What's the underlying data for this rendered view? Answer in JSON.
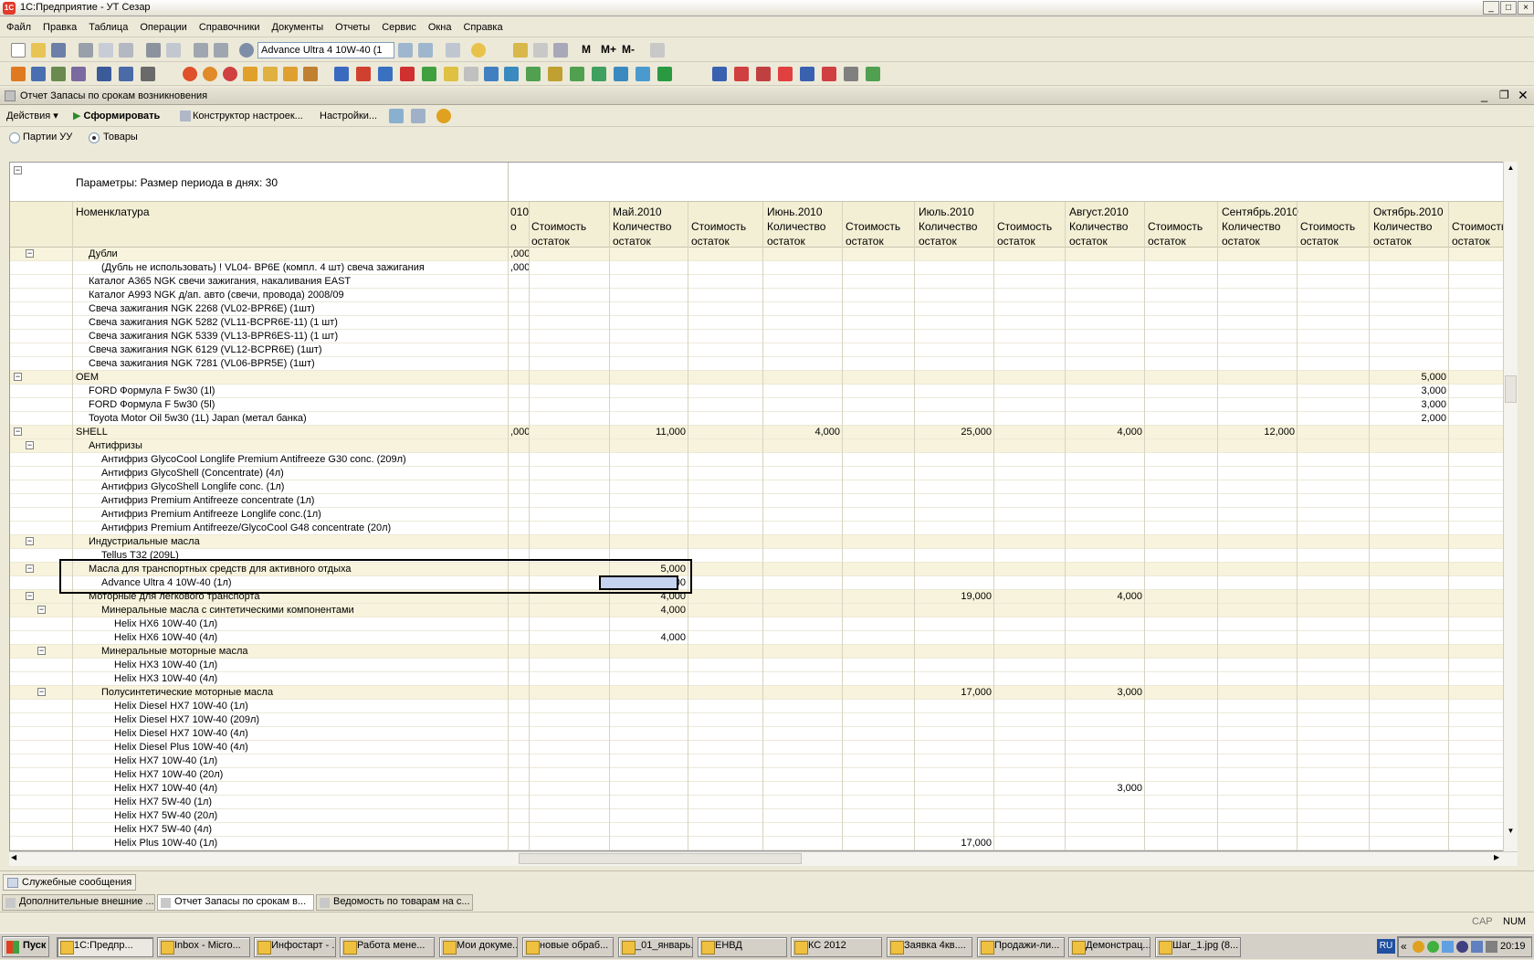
{
  "app": {
    "title": "1С:Предприятие - УТ Сезар",
    "logo": "1С"
  },
  "menu": [
    "Файл",
    "Правка",
    "Таблица",
    "Операции",
    "Справочники",
    "Документы",
    "Отчеты",
    "Сервис",
    "Окна",
    "Справка"
  ],
  "toolbar": {
    "search_value": "Advance Ultra 4 10W-40 (1",
    "mem_buttons": [
      "M",
      "M+",
      "M-"
    ]
  },
  "report": {
    "title": "Отчет  Запасы по срокам возникновения",
    "actions": {
      "actions": "Действия",
      "generate": "Сформировать",
      "constructor": "Конструктор настроек...",
      "settings": "Настройки..."
    },
    "radio": {
      "opt1": "Партии УУ",
      "opt2": "Товары",
      "selected": "opt2"
    },
    "params": "Параметры:     Размер периода в днях: 30",
    "col_nom": "Номенклатура",
    "first_month_tail": "010",
    "months": [
      "Май.2010",
      "Июнь.2010",
      "Июль.2010",
      "Август.2010",
      "Сентябрь.2010",
      "Октябрь.2010"
    ],
    "qty_label_1": "Количество",
    "qty_label_2": "остаток",
    "cost_label_1": "Стоимость",
    "cost_label_2": "остаток",
    "first_col_tail": "о",
    "rows": [
      {
        "name": "Дубли",
        "indent": 1,
        "group": true,
        "pre": ",000"
      },
      {
        "name": "(Дубль не использовать) ! VL04- BP6E  (компл. 4 шт) свеча зажигания",
        "indent": 2,
        "pre": ",000"
      },
      {
        "name": "Каталог A365 NGK свечи зажигания, накаливания EAST",
        "indent": 1
      },
      {
        "name": "Каталог A993 NGK д/ап. авто (свечи, провода) 2008/09",
        "indent": 1
      },
      {
        "name": "Свеча зажигания NGK 2268  (VL02-BPR6E) (1шт)",
        "indent": 1
      },
      {
        "name": "Свеча зажигания NGK 5282 (VL11-BCPR6E-11) (1 шт)",
        "indent": 1
      },
      {
        "name": "Свеча зажигания NGK 5339 (VL13-BPR6ES-11) (1 шт)",
        "indent": 1
      },
      {
        "name": "Свеча зажигания NGK 6129 (VL12-BCPR6E) (1шт)",
        "indent": 1
      },
      {
        "name": "Свеча зажигания NGK 7281 (VL06-BPR5E) (1шт)",
        "indent": 1
      },
      {
        "name": "OEM",
        "indent": 0,
        "group": true,
        "v": {
          "oct": "5,000"
        }
      },
      {
        "name": "FORD Формула F 5w30 (1l)",
        "indent": 1,
        "v": {
          "oct": "3,000"
        }
      },
      {
        "name": "FORD Формула F 5w30 (5l)",
        "indent": 1,
        "v": {
          "oct": "3,000"
        }
      },
      {
        "name": "Toyota Motor Oil 5w30 (1L) Japan (метал банка)",
        "indent": 1,
        "v": {
          "oct": "2,000"
        }
      },
      {
        "name": "SHELL",
        "indent": 0,
        "group": true,
        "pre": ",000",
        "v": {
          "may": "11,000",
          "jun": "4,000",
          "jul": "25,000",
          "aug": "4,000",
          "sep": "12,000"
        }
      },
      {
        "name": "Антифризы",
        "indent": 1,
        "group": true
      },
      {
        "name": "Антифриз GlycoCool Longlife Premium Antifreeze G30 conc. (209л)",
        "indent": 2
      },
      {
        "name": "Антифриз GlycoShell (Concentrate) (4л)",
        "indent": 2
      },
      {
        "name": "Антифриз GlycoShell Longlife conc. (1л)",
        "indent": 2
      },
      {
        "name": "Антифриз Premium Antifreeze concentrate (1л)",
        "indent": 2
      },
      {
        "name": "Антифриз Premium Antifreeze Longlife conc.(1л)",
        "indent": 2
      },
      {
        "name": "Антифриз Premium Antifreeze/GlycoCool G48 concentrate (20л)",
        "indent": 2
      },
      {
        "name": "Индустриальные масла",
        "indent": 1,
        "group": true
      },
      {
        "name": "Tellus T32 (209L)",
        "indent": 2
      },
      {
        "name": "Масла для транспортных средств для активного отдыха",
        "indent": 1,
        "group": true,
        "v": {
          "may": "5,000"
        }
      },
      {
        "name": "Advance Ultra 4 10W-40 (1л)",
        "indent": 2,
        "v": {
          "may": "5,000"
        },
        "selected": true
      },
      {
        "name": "Моторные для легкового транспорта",
        "indent": 1,
        "group": true,
        "v": {
          "may": "4,000",
          "jul": "19,000",
          "aug": "4,000"
        }
      },
      {
        "name": "Минеральные масла с синтетическими компонентами",
        "indent": 2,
        "group": true,
        "v": {
          "may": "4,000"
        }
      },
      {
        "name": "Helix HX6 10W-40 (1л)",
        "indent": 3
      },
      {
        "name": "Helix HX6 10W-40 (4л)",
        "indent": 3,
        "v": {
          "may": "4,000"
        }
      },
      {
        "name": "Минеральные моторные масла",
        "indent": 2,
        "group": true
      },
      {
        "name": "Helix HX3 10W-40 (1л)",
        "indent": 3
      },
      {
        "name": "Helix HX3 10W-40 (4л)",
        "indent": 3
      },
      {
        "name": "Полусинтетические моторные масла",
        "indent": 2,
        "group": true,
        "v": {
          "jul": "17,000",
          "aug": "3,000"
        }
      },
      {
        "name": "Helix Diesel HX7 10W-40 (1л)",
        "indent": 3
      },
      {
        "name": "Helix Diesel HX7 10W-40 (209л)",
        "indent": 3
      },
      {
        "name": "Helix Diesel HX7 10W-40 (4л)",
        "indent": 3
      },
      {
        "name": "Helix Diesel Plus 10W-40 (4л)",
        "indent": 3
      },
      {
        "name": "Helix HX7 10W-40 (1л)",
        "indent": 3
      },
      {
        "name": "Helix HX7 10W-40 (20л)",
        "indent": 3
      },
      {
        "name": "Helix HX7 10W-40 (4л)",
        "indent": 3,
        "v": {
          "aug": "3,000"
        }
      },
      {
        "name": "Helix HX7 5W-40 (1л)",
        "indent": 3
      },
      {
        "name": "Helix HX7 5W-40 (20л)",
        "indent": 3
      },
      {
        "name": "Helix HX7 5W-40 (4л)",
        "indent": 3
      },
      {
        "name": "Helix Plus 10W-40 (1л)",
        "indent": 3,
        "v": {
          "jul": "17,000"
        }
      }
    ]
  },
  "service_messages": "Служебные сообщения",
  "window_tabs": [
    "Дополнительные внешние ...",
    "Отчет  Запасы по срокам в...",
    "Ведомость по товарам на с..."
  ],
  "status": {
    "cap": "CAP",
    "num": "NUM"
  },
  "taskbar": {
    "start": "Пуск",
    "lang": "RU",
    "clock": "20:19",
    "tasks": [
      "1С:Предпр...",
      "Inbox - Micro...",
      "Инфостарт - ...",
      "Работа мене...",
      "Мои докуме...",
      "новые обраб...",
      "_01_январь...",
      "ЕНВД",
      "КС 2012",
      "Заявка 4кв....",
      "Продажи-ли...",
      "Демонстрац...",
      "Шаг_1.jpg (8..."
    ]
  },
  "colors": {
    "group_row": "#f7f3dc",
    "header": "#f3efd5",
    "chrome": "#ece9d8"
  }
}
